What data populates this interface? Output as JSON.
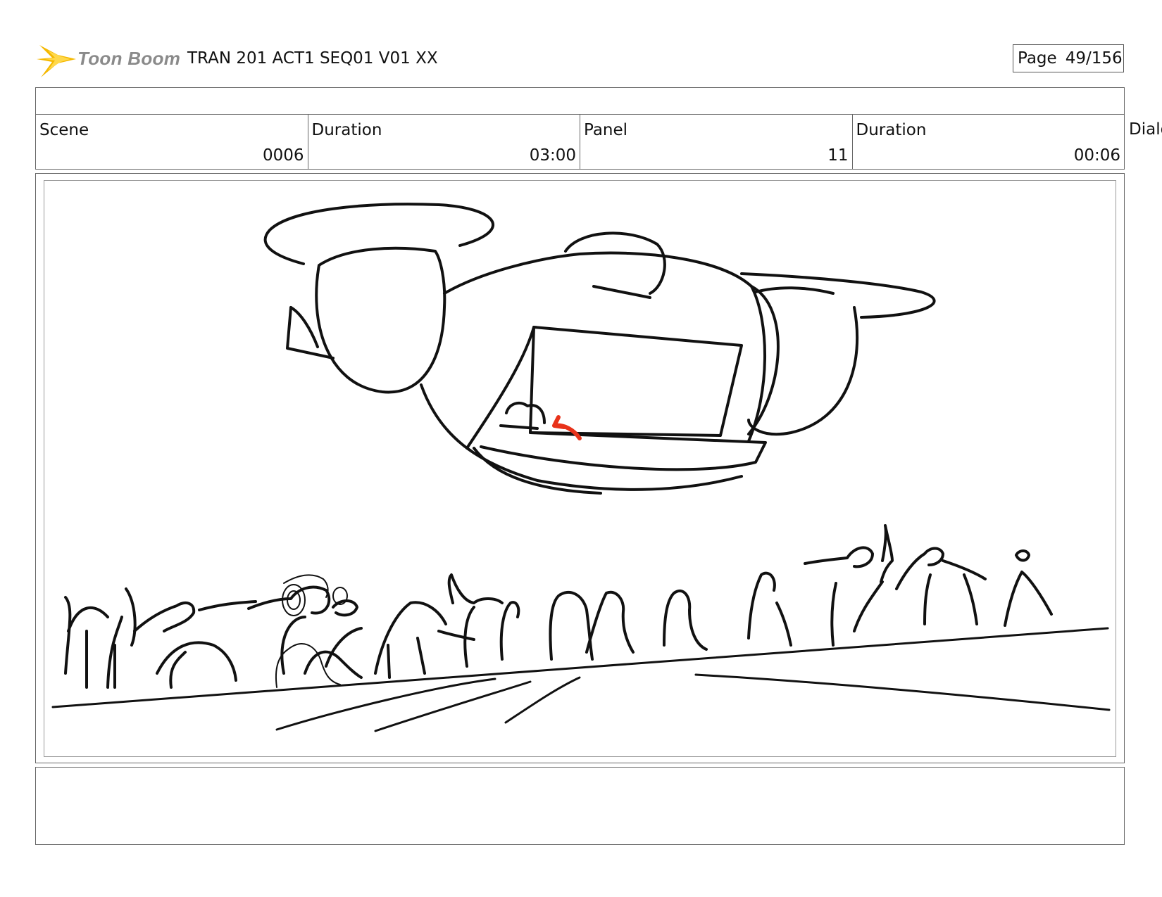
{
  "header": {
    "logo_text": "Toon Boom",
    "document_title": "TRAN 201 ACT1 SEQ01 V01 XX",
    "page_label": "Page",
    "page_number": "49/156"
  },
  "info": {
    "scene_label": "Scene",
    "scene_value": "0006",
    "scene_duration_label": "Duration",
    "scene_duration_value": "03:00",
    "panel_label": "Panel",
    "panel_value": "11",
    "panel_duration_label": "Duration",
    "panel_duration_value": "00:06",
    "overflow_label": "Dialo"
  },
  "colors": {
    "logo_star": "#f5b800",
    "ink": "#111111",
    "action_arrow": "#e8321a"
  },
  "icons": {
    "logo": "starburst-icon",
    "arrow": "action-arrow-icon"
  },
  "notes": {
    "text": ""
  }
}
